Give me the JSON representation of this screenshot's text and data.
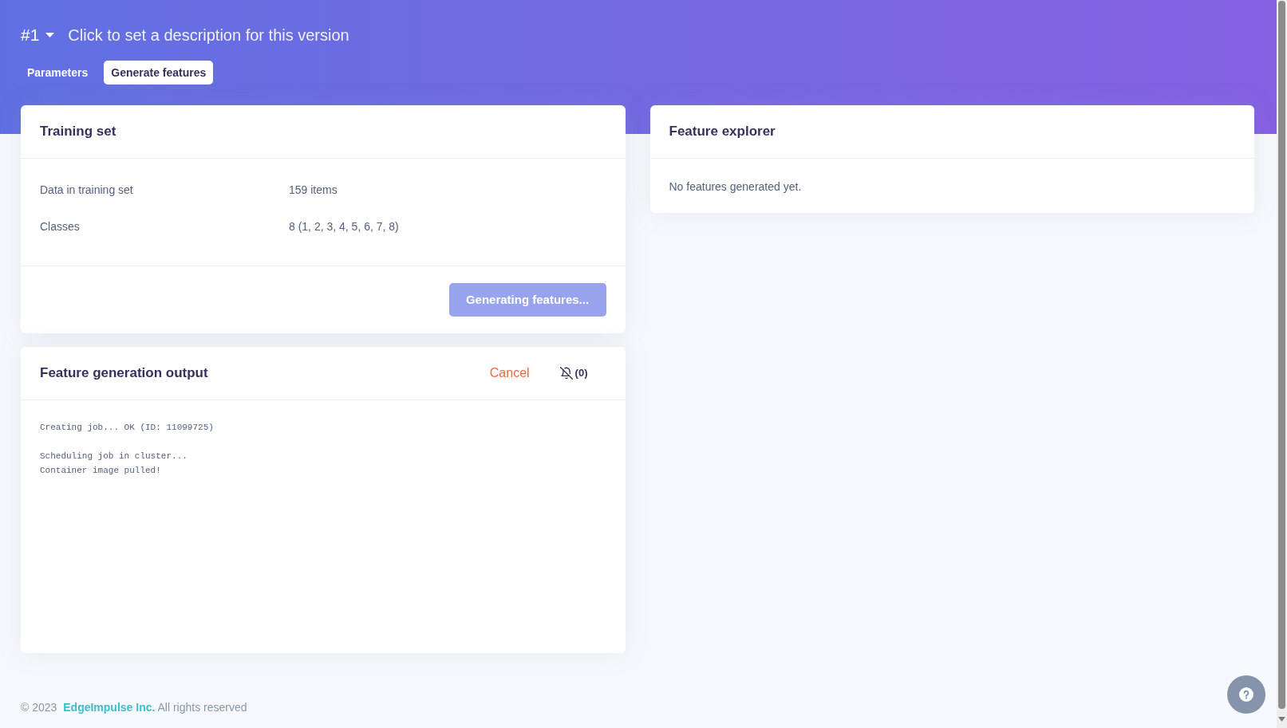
{
  "header": {
    "version": "#1",
    "description": "Click to set a description for this version"
  },
  "tabs": [
    {
      "label": "Parameters",
      "selected": false
    },
    {
      "label": "Generate features",
      "selected": true
    }
  ],
  "training_set": {
    "title": "Training set",
    "rows": [
      {
        "label": "Data in training set",
        "value": "159 items"
      },
      {
        "label": "Classes",
        "value": "8 (1, 2, 3, 4, 5, 6, 7, 8)"
      }
    ],
    "button": {
      "label": "Generating features...",
      "disabled": true
    }
  },
  "output": {
    "title": "Feature generation output",
    "cancel": "Cancel",
    "notifications": "(0)",
    "log": "Creating job... OK (ID: 11099725)\n\nScheduling job in cluster...\nContainer image pulled!"
  },
  "feature_explorer": {
    "title": "Feature explorer",
    "message": "No features generated yet."
  },
  "footer": {
    "copyright": "© 2023",
    "company": "EdgeImpulse Inc.",
    "rights": "All rights reserved"
  }
}
